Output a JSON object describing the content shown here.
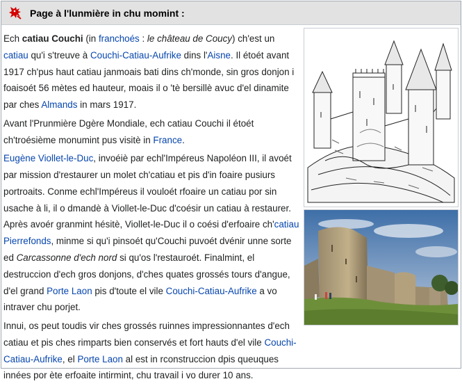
{
  "portal": {
    "title": "Page à l'lunmière in chu momint :"
  },
  "article": {
    "p1": {
      "t1": "Ech ",
      "bold": "catiau Couchi",
      "t2": " (in ",
      "link_franchoes": "franchoés",
      "t3": " : ",
      "italic": "le château de Coucy",
      "t4": ") ch'est un ",
      "link_catiau": "catiau",
      "t5": " qu'i s'treuve à ",
      "link_couchi": "Couchi-Catiau-Aufrike",
      "t6": " dins l'",
      "link_aisne": "Aisne",
      "t7": ". Il étoét avant 1917 ch'pus haut catiau janmoais bati dins ch'monde, sin gros donjon i foaisoét 56 mètes ed hauteur, moais il o 'tè bersillè avuc d'el dinamite par ches ",
      "link_almands": "Almands",
      "t8": " in mars 1917."
    },
    "p2": {
      "t1": "Avant l'Prunmière Dgère Mondiale, ech catiau Couchi il étoét ch'troésième monumint pus visitè in ",
      "link_france": "France",
      "t2": "."
    },
    "p3": {
      "link_viollet": "Eugène Viollet-le-Duc",
      "t1": ", invoéiè par echl'Impéreus Napoléon III, il avoét par mission d'restaurer un molet ch'catiau et pis d'in foaire pusiurs portroaits. Conme echl'Impéreus il vouloét rfoaire un catiau por sin usache à li, il o dmandè à Viollet-le-Duc d'coésir un catiau à restaurer. Après avoér granmint hésitè, Viollet-le-Duc il o coési d'erfoaire ch'",
      "link_pierrefonds": "catiau Pierrefonds",
      "t2": ", minme si qu'i pinsoét qu'Couchi puvoét dvénir unne sorte ed ",
      "italic": "Carcassonne d'ech nord",
      "t3": " si qu'os l'restauroét. Finalmint, el destruccion d'ech gros donjons, d'ches quates grossés tours d'angue, d'el grand ",
      "link_laon": "Porte Laon",
      "t4": " pis d'toute el vile ",
      "link_couchi": "Couchi-Catiau-Aufrike",
      "t5": " a vo intraver chu porjet."
    },
    "p4": {
      "t1": "Innui, os peut toudis vir ches grossés ruinnes impressionnantes d'ech catiau et pis ches rimparts bien conservés et fort hauts d'el vile ",
      "link_couchi": "Couchi-Catiau-Aufrike",
      "t2": ", el ",
      "link_laon": "Porte Laon",
      "t3": " al est in rconstruccion dpis queuques innées por ète erfoaite intirmint, chu travail i vo durer 10 ans."
    }
  },
  "icons": {
    "header": "heraldic-lion-icon"
  },
  "colors": {
    "link": "#0645ad",
    "header_bg": "#e2e2e2",
    "emblem_red": "#d40000"
  }
}
